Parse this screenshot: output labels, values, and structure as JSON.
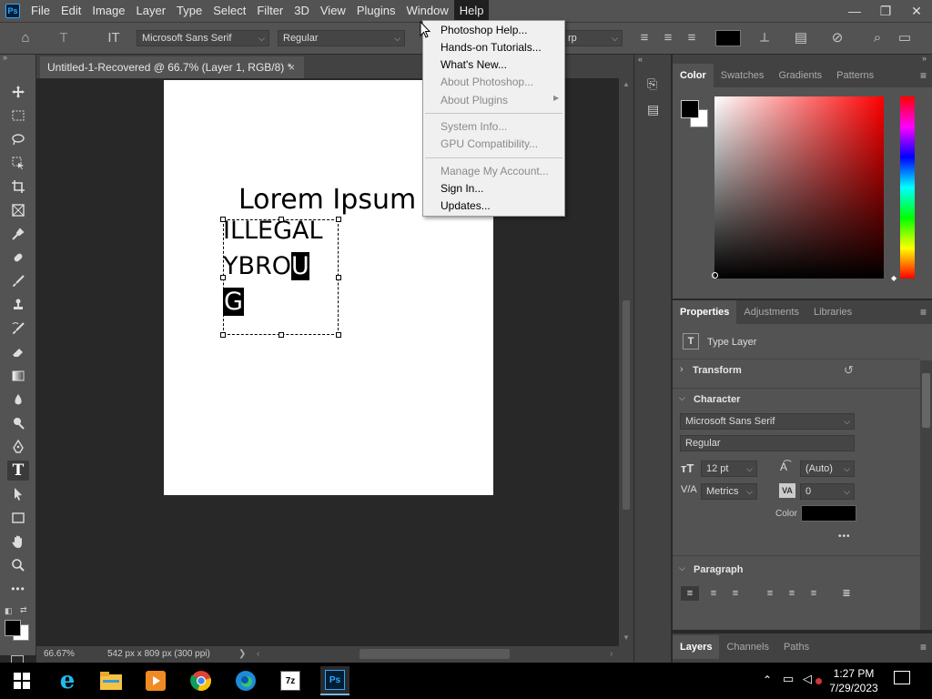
{
  "app": {
    "logo": "Ps"
  },
  "menubar": {
    "items": [
      "File",
      "Edit",
      "Image",
      "Layer",
      "Type",
      "Select",
      "Filter",
      "3D",
      "View",
      "Plugins",
      "Window",
      "Help"
    ],
    "active": "Help",
    "window_controls": {
      "minimize": "—",
      "restore": "❐",
      "close": "✕"
    }
  },
  "options": {
    "font_family": "Microsoft Sans Serif",
    "font_style": "Regular",
    "aa_partial": "rp",
    "color": "#000000"
  },
  "document": {
    "tab_title": "Untitled-1-Recovered @ 66.7% (Layer 1, RGB/8) *",
    "close": "×",
    "heading_text": "Lorem Ipsum",
    "line1": "ILLEGAL",
    "line2a": "YBRO",
    "line2b": "U",
    "line3": "G"
  },
  "status": {
    "zoom": "66.67%",
    "doc_info": "542 px x 809 px (300 ppi)",
    "arrow": "❯"
  },
  "help_menu": {
    "items": [
      {
        "label": "Photoshop Help...",
        "disabled": false
      },
      {
        "label": "Hands-on Tutorials...",
        "disabled": false
      },
      {
        "label": "What's New...",
        "disabled": false
      },
      {
        "label": "About Photoshop...",
        "disabled": true
      },
      {
        "label": "About Plugins",
        "disabled": true,
        "submenu": true
      },
      {
        "label": "System Info...",
        "disabled": true
      },
      {
        "label": "GPU Compatibility...",
        "disabled": true
      },
      {
        "label": "Manage My Account...",
        "disabled": true
      },
      {
        "label": "Sign In...",
        "disabled": false
      },
      {
        "label": "Updates...",
        "disabled": false
      }
    ]
  },
  "color_panel": {
    "tabs": [
      "Color",
      "Swatches",
      "Gradients",
      "Patterns"
    ],
    "active": "Color",
    "fg": "#000000",
    "bg": "#ffffff",
    "hue": "#ff0000"
  },
  "properties_panel": {
    "tabs": [
      "Properties",
      "Adjustments",
      "Libraries"
    ],
    "active": "Properties",
    "layer_type": "Type Layer",
    "transform": "Transform",
    "character": "Character",
    "font_family": "Microsoft Sans Serif",
    "font_style": "Regular",
    "size": "12 pt",
    "leading": "(Auto)",
    "kerning": "Metrics",
    "tracking": "0",
    "color_label": "Color",
    "more": "•••",
    "paragraph": "Paragraph"
  },
  "layers_panel": {
    "tabs": [
      "Layers",
      "Channels",
      "Paths"
    ],
    "active": "Layers"
  },
  "taskbar": {
    "time": "1:27 PM",
    "date": "7/29/2023"
  }
}
